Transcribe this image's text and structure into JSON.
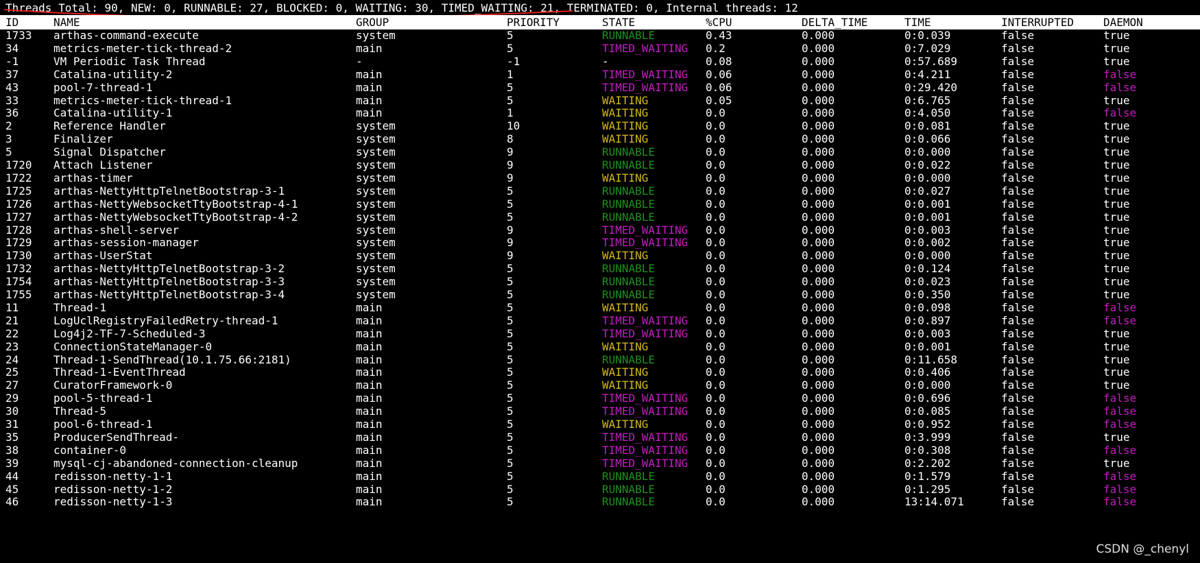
{
  "summary": "Threads Total: 90, NEW: 0, RUNNABLE: 27, BLOCKED: 0, WAITING: 30, TIMED_WAITING: 21, TERMINATED: 0, Internal threads: 12",
  "columns": [
    "ID",
    "NAME",
    "GROUP",
    "PRIORITY",
    "STATE",
    "%CPU",
    "DELTA_TIME",
    "TIME",
    "INTERRUPTED",
    "DAEMON"
  ],
  "rows": [
    {
      "id": "1733",
      "name": "arthas-command-execute",
      "group": "system",
      "priority": "5",
      "state": "RUNNABLE",
      "cpu": "0.43",
      "delta": "0.000",
      "time": "0:0.039",
      "interrupted": "false",
      "daemon": "true"
    },
    {
      "id": "34",
      "name": "metrics-meter-tick-thread-2",
      "group": "main",
      "priority": "5",
      "state": "TIMED_WAITING",
      "cpu": "0.2",
      "delta": "0.000",
      "time": "0:7.029",
      "interrupted": "false",
      "daemon": "true"
    },
    {
      "id": "-1",
      "name": "VM Periodic Task Thread",
      "group": "-",
      "priority": "-1",
      "state": "-",
      "cpu": "0.08",
      "delta": "0.000",
      "time": "0:57.689",
      "interrupted": "false",
      "daemon": "true"
    },
    {
      "id": "37",
      "name": "Catalina-utility-2",
      "group": "main",
      "priority": "1",
      "state": "TIMED_WAITING",
      "cpu": "0.06",
      "delta": "0.000",
      "time": "0:4.211",
      "interrupted": "false",
      "daemon": "false"
    },
    {
      "id": "43",
      "name": "pool-7-thread-1",
      "group": "main",
      "priority": "5",
      "state": "TIMED_WAITING",
      "cpu": "0.06",
      "delta": "0.000",
      "time": "0:29.420",
      "interrupted": "false",
      "daemon": "false"
    },
    {
      "id": "33",
      "name": "metrics-meter-tick-thread-1",
      "group": "main",
      "priority": "5",
      "state": "WAITING",
      "cpu": "0.05",
      "delta": "0.000",
      "time": "0:6.765",
      "interrupted": "false",
      "daemon": "true"
    },
    {
      "id": "36",
      "name": "Catalina-utility-1",
      "group": "main",
      "priority": "1",
      "state": "WAITING",
      "cpu": "0.0",
      "delta": "0.000",
      "time": "0:4.050",
      "interrupted": "false",
      "daemon": "false"
    },
    {
      "id": "2",
      "name": "Reference Handler",
      "group": "system",
      "priority": "10",
      "state": "WAITING",
      "cpu": "0.0",
      "delta": "0.000",
      "time": "0:0.081",
      "interrupted": "false",
      "daemon": "true"
    },
    {
      "id": "3",
      "name": "Finalizer",
      "group": "system",
      "priority": "8",
      "state": "WAITING",
      "cpu": "0.0",
      "delta": "0.000",
      "time": "0:0.066",
      "interrupted": "false",
      "daemon": "true"
    },
    {
      "id": "5",
      "name": "Signal Dispatcher",
      "group": "system",
      "priority": "9",
      "state": "RUNNABLE",
      "cpu": "0.0",
      "delta": "0.000",
      "time": "0:0.000",
      "interrupted": "false",
      "daemon": "true"
    },
    {
      "id": "1720",
      "name": "Attach Listener",
      "group": "system",
      "priority": "9",
      "state": "RUNNABLE",
      "cpu": "0.0",
      "delta": "0.000",
      "time": "0:0.022",
      "interrupted": "false",
      "daemon": "true"
    },
    {
      "id": "1722",
      "name": "arthas-timer",
      "group": "system",
      "priority": "9",
      "state": "WAITING",
      "cpu": "0.0",
      "delta": "0.000",
      "time": "0:0.000",
      "interrupted": "false",
      "daemon": "true"
    },
    {
      "id": "1725",
      "name": "arthas-NettyHttpTelnetBootstrap-3-1",
      "group": "system",
      "priority": "5",
      "state": "RUNNABLE",
      "cpu": "0.0",
      "delta": "0.000",
      "time": "0:0.027",
      "interrupted": "false",
      "daemon": "true"
    },
    {
      "id": "1726",
      "name": "arthas-NettyWebsocketTtyBootstrap-4-1",
      "group": "system",
      "priority": "5",
      "state": "RUNNABLE",
      "cpu": "0.0",
      "delta": "0.000",
      "time": "0:0.001",
      "interrupted": "false",
      "daemon": "true"
    },
    {
      "id": "1727",
      "name": "arthas-NettyWebsocketTtyBootstrap-4-2",
      "group": "system",
      "priority": "5",
      "state": "RUNNABLE",
      "cpu": "0.0",
      "delta": "0.000",
      "time": "0:0.001",
      "interrupted": "false",
      "daemon": "true"
    },
    {
      "id": "1728",
      "name": "arthas-shell-server",
      "group": "system",
      "priority": "9",
      "state": "TIMED_WAITING",
      "cpu": "0.0",
      "delta": "0.000",
      "time": "0:0.003",
      "interrupted": "false",
      "daemon": "true"
    },
    {
      "id": "1729",
      "name": "arthas-session-manager",
      "group": "system",
      "priority": "9",
      "state": "TIMED_WAITING",
      "cpu": "0.0",
      "delta": "0.000",
      "time": "0:0.002",
      "interrupted": "false",
      "daemon": "true"
    },
    {
      "id": "1730",
      "name": "arthas-UserStat",
      "group": "system",
      "priority": "9",
      "state": "WAITING",
      "cpu": "0.0",
      "delta": "0.000",
      "time": "0:0.000",
      "interrupted": "false",
      "daemon": "true"
    },
    {
      "id": "1732",
      "name": "arthas-NettyHttpTelnetBootstrap-3-2",
      "group": "system",
      "priority": "5",
      "state": "RUNNABLE",
      "cpu": "0.0",
      "delta": "0.000",
      "time": "0:0.124",
      "interrupted": "false",
      "daemon": "true"
    },
    {
      "id": "1754",
      "name": "arthas-NettyHttpTelnetBootstrap-3-3",
      "group": "system",
      "priority": "5",
      "state": "RUNNABLE",
      "cpu": "0.0",
      "delta": "0.000",
      "time": "0:0.023",
      "interrupted": "false",
      "daemon": "true"
    },
    {
      "id": "1755",
      "name": "arthas-NettyHttpTelnetBootstrap-3-4",
      "group": "system",
      "priority": "5",
      "state": "RUNNABLE",
      "cpu": "0.0",
      "delta": "0.000",
      "time": "0:0.350",
      "interrupted": "false",
      "daemon": "true"
    },
    {
      "id": "11",
      "name": "Thread-1",
      "group": "main",
      "priority": "5",
      "state": "WAITING",
      "cpu": "0.0",
      "delta": "0.000",
      "time": "0:0.098",
      "interrupted": "false",
      "daemon": "false"
    },
    {
      "id": "21",
      "name": "LogUclRegistryFailedRetry-thread-1",
      "group": "main",
      "priority": "5",
      "state": "TIMED_WAITING",
      "cpu": "0.0",
      "delta": "0.000",
      "time": "0:0.897",
      "interrupted": "false",
      "daemon": "false"
    },
    {
      "id": "22",
      "name": "Log4j2-TF-7-Scheduled-3",
      "group": "main",
      "priority": "5",
      "state": "TIMED_WAITING",
      "cpu": "0.0",
      "delta": "0.000",
      "time": "0:0.003",
      "interrupted": "false",
      "daemon": "true"
    },
    {
      "id": "23",
      "name": "ConnectionStateManager-0",
      "group": "main",
      "priority": "5",
      "state": "WAITING",
      "cpu": "0.0",
      "delta": "0.000",
      "time": "0:0.001",
      "interrupted": "false",
      "daemon": "true"
    },
    {
      "id": "24",
      "name": "Thread-1-SendThread(10.1.75.66:2181)",
      "group": "main",
      "priority": "5",
      "state": "RUNNABLE",
      "cpu": "0.0",
      "delta": "0.000",
      "time": "0:11.658",
      "interrupted": "false",
      "daemon": "true"
    },
    {
      "id": "25",
      "name": "Thread-1-EventThread",
      "group": "main",
      "priority": "5",
      "state": "WAITING",
      "cpu": "0.0",
      "delta": "0.000",
      "time": "0:0.406",
      "interrupted": "false",
      "daemon": "true"
    },
    {
      "id": "27",
      "name": "CuratorFramework-0",
      "group": "main",
      "priority": "5",
      "state": "WAITING",
      "cpu": "0.0",
      "delta": "0.000",
      "time": "0:0.000",
      "interrupted": "false",
      "daemon": "true"
    },
    {
      "id": "29",
      "name": "pool-5-thread-1",
      "group": "main",
      "priority": "5",
      "state": "TIMED_WAITING",
      "cpu": "0.0",
      "delta": "0.000",
      "time": "0:0.696",
      "interrupted": "false",
      "daemon": "false"
    },
    {
      "id": "30",
      "name": "Thread-5",
      "group": "main",
      "priority": "5",
      "state": "TIMED_WAITING",
      "cpu": "0.0",
      "delta": "0.000",
      "time": "0:0.085",
      "interrupted": "false",
      "daemon": "false"
    },
    {
      "id": "31",
      "name": "pool-6-thread-1",
      "group": "main",
      "priority": "5",
      "state": "WAITING",
      "cpu": "0.0",
      "delta": "0.000",
      "time": "0:0.952",
      "interrupted": "false",
      "daemon": "false"
    },
    {
      "id": "35",
      "name": "ProducerSendThread-",
      "group": "main",
      "priority": "5",
      "state": "TIMED_WAITING",
      "cpu": "0.0",
      "delta": "0.000",
      "time": "0:3.999",
      "interrupted": "false",
      "daemon": "true"
    },
    {
      "id": "38",
      "name": "container-0",
      "group": "main",
      "priority": "5",
      "state": "TIMED_WAITING",
      "cpu": "0.0",
      "delta": "0.000",
      "time": "0:0.308",
      "interrupted": "false",
      "daemon": "false"
    },
    {
      "id": "39",
      "name": "mysql-cj-abandoned-connection-cleanup",
      "group": "main",
      "priority": "5",
      "state": "TIMED_WAITING",
      "cpu": "0.0",
      "delta": "0.000",
      "time": "0:2.202",
      "interrupted": "false",
      "daemon": "true"
    },
    {
      "id": "44",
      "name": "redisson-netty-1-1",
      "group": "main",
      "priority": "5",
      "state": "RUNNABLE",
      "cpu": "0.0",
      "delta": "0.000",
      "time": "0:1.579",
      "interrupted": "false",
      "daemon": "false"
    },
    {
      "id": "45",
      "name": "redisson-netty-1-2",
      "group": "main",
      "priority": "5",
      "state": "RUNNABLE",
      "cpu": "0.0",
      "delta": "0.000",
      "time": "0:1.295",
      "interrupted": "false",
      "daemon": "false"
    },
    {
      "id": "46",
      "name": "redisson-netty-1-3",
      "group": "main",
      "priority": "5",
      "state": "RUNNABLE",
      "cpu": "0.0",
      "delta": "0.000",
      "time": "13:14.071",
      "interrupted": "false",
      "daemon": "false"
    }
  ],
  "watermark": "CSDN @_chenyl",
  "colors": {
    "background": "#000000",
    "text": "#ffffff",
    "header_bg": "#ffffff",
    "runnable": "#1f8f1f",
    "timed_waiting": "#c51bc5",
    "waiting": "#d4b81a",
    "daemon_false": "#c51bc5",
    "annotation": "#e02020"
  }
}
